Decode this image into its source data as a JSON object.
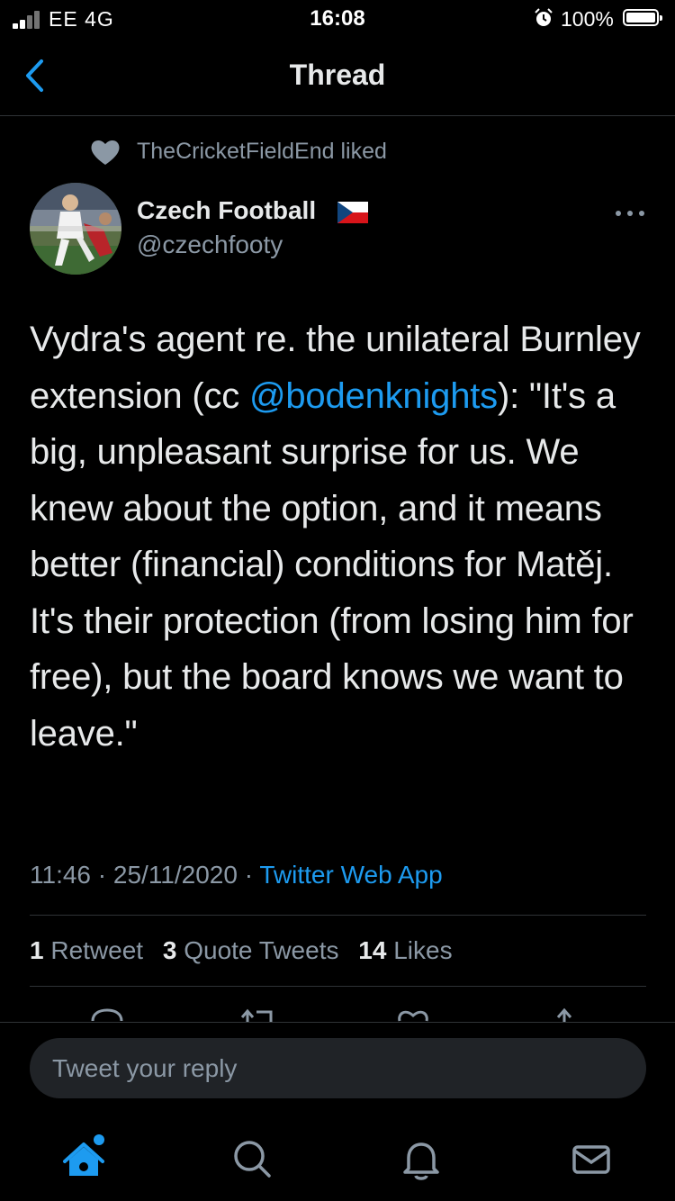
{
  "status_bar": {
    "carrier": "EE  4G",
    "time": "16:08",
    "battery": "100%"
  },
  "nav": {
    "title": "Thread"
  },
  "social_context": {
    "text": "TheCricketFieldEnd liked"
  },
  "author": {
    "name": "Czech Football",
    "handle": "@czechfooty"
  },
  "tweet": {
    "text_part1": "Vydra's agent re. the unilateral Burnley extension (cc ",
    "mention": "@bodenknights",
    "text_part2": "): \"It's a big, unpleasant surprise for us. We knew about the option, and it means better (financial) conditions for Matěj. It's their protection (from losing him for free), but the board knows we want to leave.\"",
    "time": "11:46",
    "date": "25/11/2020",
    "source": "Twitter Web App"
  },
  "stats": {
    "retweets_count": "1",
    "retweets_label": "Retweet",
    "quotes_count": "3",
    "quotes_label": "Quote Tweets",
    "likes_count": "14",
    "likes_label": "Likes"
  },
  "reply": {
    "placeholder": "Tweet your reply"
  },
  "colors": {
    "background": "#000000",
    "accent": "#1d9bf0",
    "secondary_text": "#8b98a5",
    "primary_text": "#e7e9ea"
  },
  "icons": {
    "back": "chevron-left-icon",
    "liked": "heart-icon",
    "more": "more-dots-icon",
    "reply": "reply-icon",
    "retweet": "retweet-icon",
    "like": "like-icon",
    "share": "share-icon",
    "home": "home-icon",
    "search": "search-icon",
    "notifications": "bell-icon",
    "messages": "mail-icon"
  }
}
